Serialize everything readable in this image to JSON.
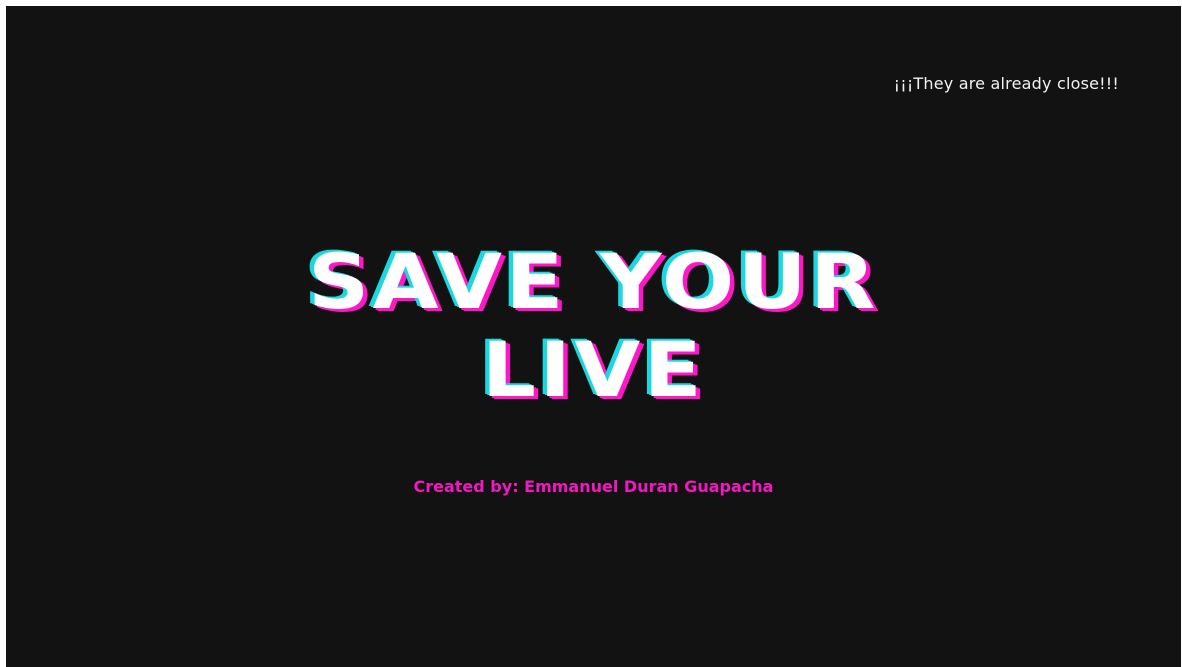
{
  "tagline": "¡¡¡They are already close!!!",
  "title": {
    "line1": "SAVE YOUR",
    "line2": "LIVE"
  },
  "credit": "Created by: Emmanuel Duran Guapacha",
  "colors": {
    "background": "#121212",
    "title_text": "#ffffff",
    "glitch_cyan": "#19d8e0",
    "glitch_magenta": "#ff16c8",
    "credit_text": "#f218c0",
    "tagline_text": "#f2f2f2"
  }
}
